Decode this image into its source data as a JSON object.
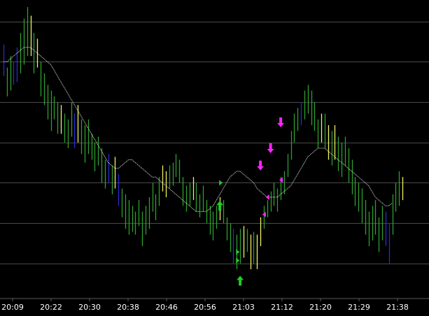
{
  "colors": {
    "background": "#000000",
    "grid": "#4a4a4a",
    "tick_text": "#ffffff",
    "bar_default": "#2e9e2e",
    "bar_yellow": "#f0f060",
    "bar_blue": "#2a2ad0",
    "moving_average": "#e8e8e8",
    "signal_buy": "#22cc22",
    "signal_sell": "#ff22ff"
  },
  "chart_data": {
    "type": "bar",
    "title": "",
    "xlabel": "",
    "ylabel": "",
    "x_ticks": [
      "20:09",
      "20:22",
      "20:30",
      "20:38",
      "20:46",
      "20:56",
      "21:03",
      "21:12",
      "21:20",
      "21:29",
      "21:38"
    ],
    "ylim": [
      0,
      100
    ],
    "grid": true,
    "gridlines_y": [
      94,
      80,
      66,
      52,
      38,
      24,
      10
    ],
    "bars": [
      [
        0,
        75,
        86,
        "b"
      ],
      [
        1,
        68,
        78,
        "g"
      ],
      [
        2,
        70,
        82,
        "g"
      ],
      [
        3,
        72,
        80,
        "b"
      ],
      [
        4,
        73,
        85,
        "b"
      ],
      [
        5,
        76,
        90,
        "g"
      ],
      [
        6,
        79,
        95,
        "g"
      ],
      [
        7,
        82,
        99,
        "g"
      ],
      [
        8,
        82,
        96,
        "y"
      ],
      [
        9,
        76,
        90,
        "g"
      ],
      [
        10,
        78,
        88,
        "y"
      ],
      [
        11,
        68,
        80,
        "g"
      ],
      [
        12,
        65,
        76,
        "g"
      ],
      [
        13,
        60,
        72,
        "g"
      ],
      [
        14,
        56,
        70,
        "g"
      ],
      [
        15,
        60,
        68,
        "g"
      ],
      [
        16,
        55,
        66,
        "g"
      ],
      [
        17,
        55,
        65,
        "y"
      ],
      [
        18,
        52,
        62,
        "g"
      ],
      [
        19,
        50,
        60,
        "g"
      ],
      [
        20,
        54,
        66,
        "g"
      ],
      [
        21,
        50,
        62,
        "b"
      ],
      [
        22,
        52,
        65,
        "y"
      ],
      [
        23,
        48,
        60,
        "g"
      ],
      [
        24,
        45,
        58,
        "g"
      ],
      [
        25,
        48,
        60,
        "g"
      ],
      [
        26,
        46,
        55,
        "g"
      ],
      [
        27,
        42,
        52,
        "g"
      ],
      [
        28,
        44,
        54,
        "g"
      ],
      [
        29,
        38,
        50,
        "g"
      ],
      [
        30,
        36,
        46,
        "g"
      ],
      [
        31,
        38,
        48,
        "b"
      ],
      [
        32,
        34,
        44,
        "g"
      ],
      [
        33,
        36,
        47,
        "y"
      ],
      [
        34,
        30,
        41,
        "b"
      ],
      [
        35,
        26,
        36,
        "g"
      ],
      [
        36,
        22,
        34,
        "g"
      ],
      [
        37,
        20,
        32,
        "g"
      ],
      [
        38,
        21,
        30,
        "g"
      ],
      [
        39,
        20,
        28,
        "g"
      ],
      [
        40,
        23,
        32,
        "g"
      ],
      [
        41,
        16,
        28,
        "g"
      ],
      [
        42,
        20,
        30,
        "g"
      ],
      [
        43,
        22,
        33,
        "g"
      ],
      [
        44,
        28,
        38,
        "g"
      ],
      [
        45,
        25,
        34,
        "g"
      ],
      [
        46,
        30,
        40,
        "g"
      ],
      [
        47,
        35,
        44,
        "y"
      ],
      [
        48,
        33,
        42,
        "y"
      ],
      [
        49,
        36,
        44,
        "g"
      ],
      [
        50,
        37,
        45,
        "g"
      ],
      [
        51,
        40,
        48,
        "g"
      ],
      [
        52,
        38,
        46,
        "g"
      ],
      [
        53,
        30,
        40,
        "g"
      ],
      [
        54,
        28,
        37,
        "g"
      ],
      [
        55,
        30,
        38,
        "g"
      ],
      [
        56,
        32,
        40,
        "y"
      ],
      [
        57,
        28,
        38,
        "g"
      ],
      [
        58,
        26,
        34,
        "g"
      ],
      [
        59,
        28,
        37,
        "g"
      ],
      [
        60,
        24,
        32,
        "g"
      ],
      [
        61,
        20,
        30,
        "g"
      ],
      [
        62,
        18,
        28,
        "g"
      ],
      [
        63,
        22,
        30,
        "g"
      ],
      [
        64,
        25,
        33,
        "y"
      ],
      [
        65,
        24,
        32,
        "g"
      ],
      [
        66,
        18,
        26,
        "g"
      ],
      [
        67,
        14,
        24,
        "g"
      ],
      [
        68,
        10,
        22,
        "b"
      ],
      [
        69,
        8,
        20,
        "g"
      ],
      [
        70,
        10,
        22,
        "g"
      ],
      [
        71,
        12,
        23,
        "y"
      ],
      [
        72,
        14,
        22,
        "g"
      ],
      [
        73,
        8,
        20,
        "y"
      ],
      [
        74,
        10,
        21,
        "g"
      ],
      [
        75,
        8,
        20,
        "y"
      ],
      [
        76,
        16,
        26,
        "y"
      ],
      [
        77,
        22,
        30,
        "g"
      ],
      [
        78,
        26,
        32,
        "g"
      ],
      [
        79,
        28,
        35,
        "g"
      ],
      [
        80,
        30,
        38,
        "g"
      ],
      [
        81,
        28,
        36,
        "g"
      ],
      [
        82,
        32,
        40,
        "g"
      ],
      [
        83,
        34,
        42,
        "g"
      ],
      [
        84,
        40,
        48,
        "g"
      ],
      [
        85,
        46,
        56,
        "g"
      ],
      [
        86,
        52,
        62,
        "g"
      ],
      [
        87,
        56,
        64,
        "g"
      ],
      [
        88,
        58,
        66,
        "b"
      ],
      [
        89,
        60,
        70,
        "g"
      ],
      [
        90,
        62,
        72,
        "g"
      ],
      [
        91,
        58,
        70,
        "g"
      ],
      [
        92,
        56,
        66,
        "g"
      ],
      [
        93,
        50,
        60,
        "g"
      ],
      [
        94,
        52,
        62,
        "y"
      ],
      [
        95,
        50,
        62,
        "g"
      ],
      [
        96,
        46,
        58,
        "y"
      ],
      [
        97,
        44,
        56,
        "g"
      ],
      [
        98,
        46,
        58,
        "y"
      ],
      [
        99,
        42,
        54,
        "g"
      ],
      [
        100,
        40,
        52,
        "g"
      ],
      [
        101,
        44,
        54,
        "g"
      ],
      [
        102,
        38,
        50,
        "g"
      ],
      [
        103,
        34,
        46,
        "g"
      ],
      [
        104,
        30,
        40,
        "g"
      ],
      [
        105,
        28,
        38,
        "g"
      ],
      [
        106,
        24,
        36,
        "g"
      ],
      [
        107,
        20,
        32,
        "g"
      ],
      [
        108,
        16,
        28,
        "g"
      ],
      [
        109,
        18,
        30,
        "g"
      ],
      [
        110,
        20,
        32,
        "g"
      ],
      [
        111,
        14,
        26,
        "g"
      ],
      [
        112,
        18,
        30,
        "g"
      ],
      [
        113,
        16,
        28,
        "b"
      ],
      [
        114,
        10,
        24,
        "b"
      ],
      [
        115,
        20,
        34,
        "g"
      ],
      [
        116,
        28,
        38,
        "g"
      ],
      [
        117,
        30,
        42,
        "g"
      ],
      [
        118,
        32,
        40,
        "y"
      ]
    ],
    "moving_average": [
      80,
      80,
      81,
      82,
      83,
      84,
      85,
      85,
      85,
      84,
      83,
      82,
      81,
      80,
      79,
      77,
      75,
      73,
      71,
      69,
      67,
      65,
      63,
      61,
      59,
      57,
      55,
      53,
      51,
      49,
      47,
      45,
      44,
      43,
      43,
      44,
      45,
      46,
      46,
      45,
      44,
      43,
      42,
      41,
      40,
      40,
      39,
      38,
      37,
      36,
      35,
      34,
      33,
      32,
      31,
      30,
      29,
      28,
      28,
      28,
      28,
      29,
      30,
      32,
      34,
      36,
      38,
      40,
      41,
      42,
      42,
      41,
      40,
      39,
      38,
      36,
      35,
      34,
      33,
      33,
      33,
      33,
      34,
      35,
      36,
      37,
      39,
      41,
      43,
      45,
      47,
      48,
      49,
      50,
      50,
      50,
      49,
      48,
      47,
      46,
      45,
      44,
      43,
      42,
      41,
      40,
      39,
      38,
      37,
      35,
      33,
      32,
      31,
      30,
      30,
      31
    ],
    "signals": [
      {
        "type": "buy-arrow",
        "bar": 64,
        "value": 30
      },
      {
        "type": "buy-arrow",
        "bar": 70,
        "value": 4
      },
      {
        "type": "buy-marker",
        "bar": 64,
        "value": 38
      },
      {
        "type": "buy-marker",
        "bar": 69,
        "value": 14
      },
      {
        "type": "buy-marker",
        "bar": 69,
        "value": 11
      },
      {
        "type": "sell-arrow",
        "bar": 76,
        "value": 44
      },
      {
        "type": "sell-arrow",
        "bar": 79,
        "value": 50
      },
      {
        "type": "sell-arrow",
        "bar": 82,
        "value": 59
      },
      {
        "type": "sell-marker",
        "bar": 78,
        "value": 33
      },
      {
        "type": "sell-marker",
        "bar": 82,
        "value": 39
      },
      {
        "type": "sell-marker",
        "bar": 77,
        "value": 27
      }
    ],
    "marker_legend": {
      "g": "bar_default",
      "y": "bar_yellow",
      "b": "bar_blue"
    }
  }
}
